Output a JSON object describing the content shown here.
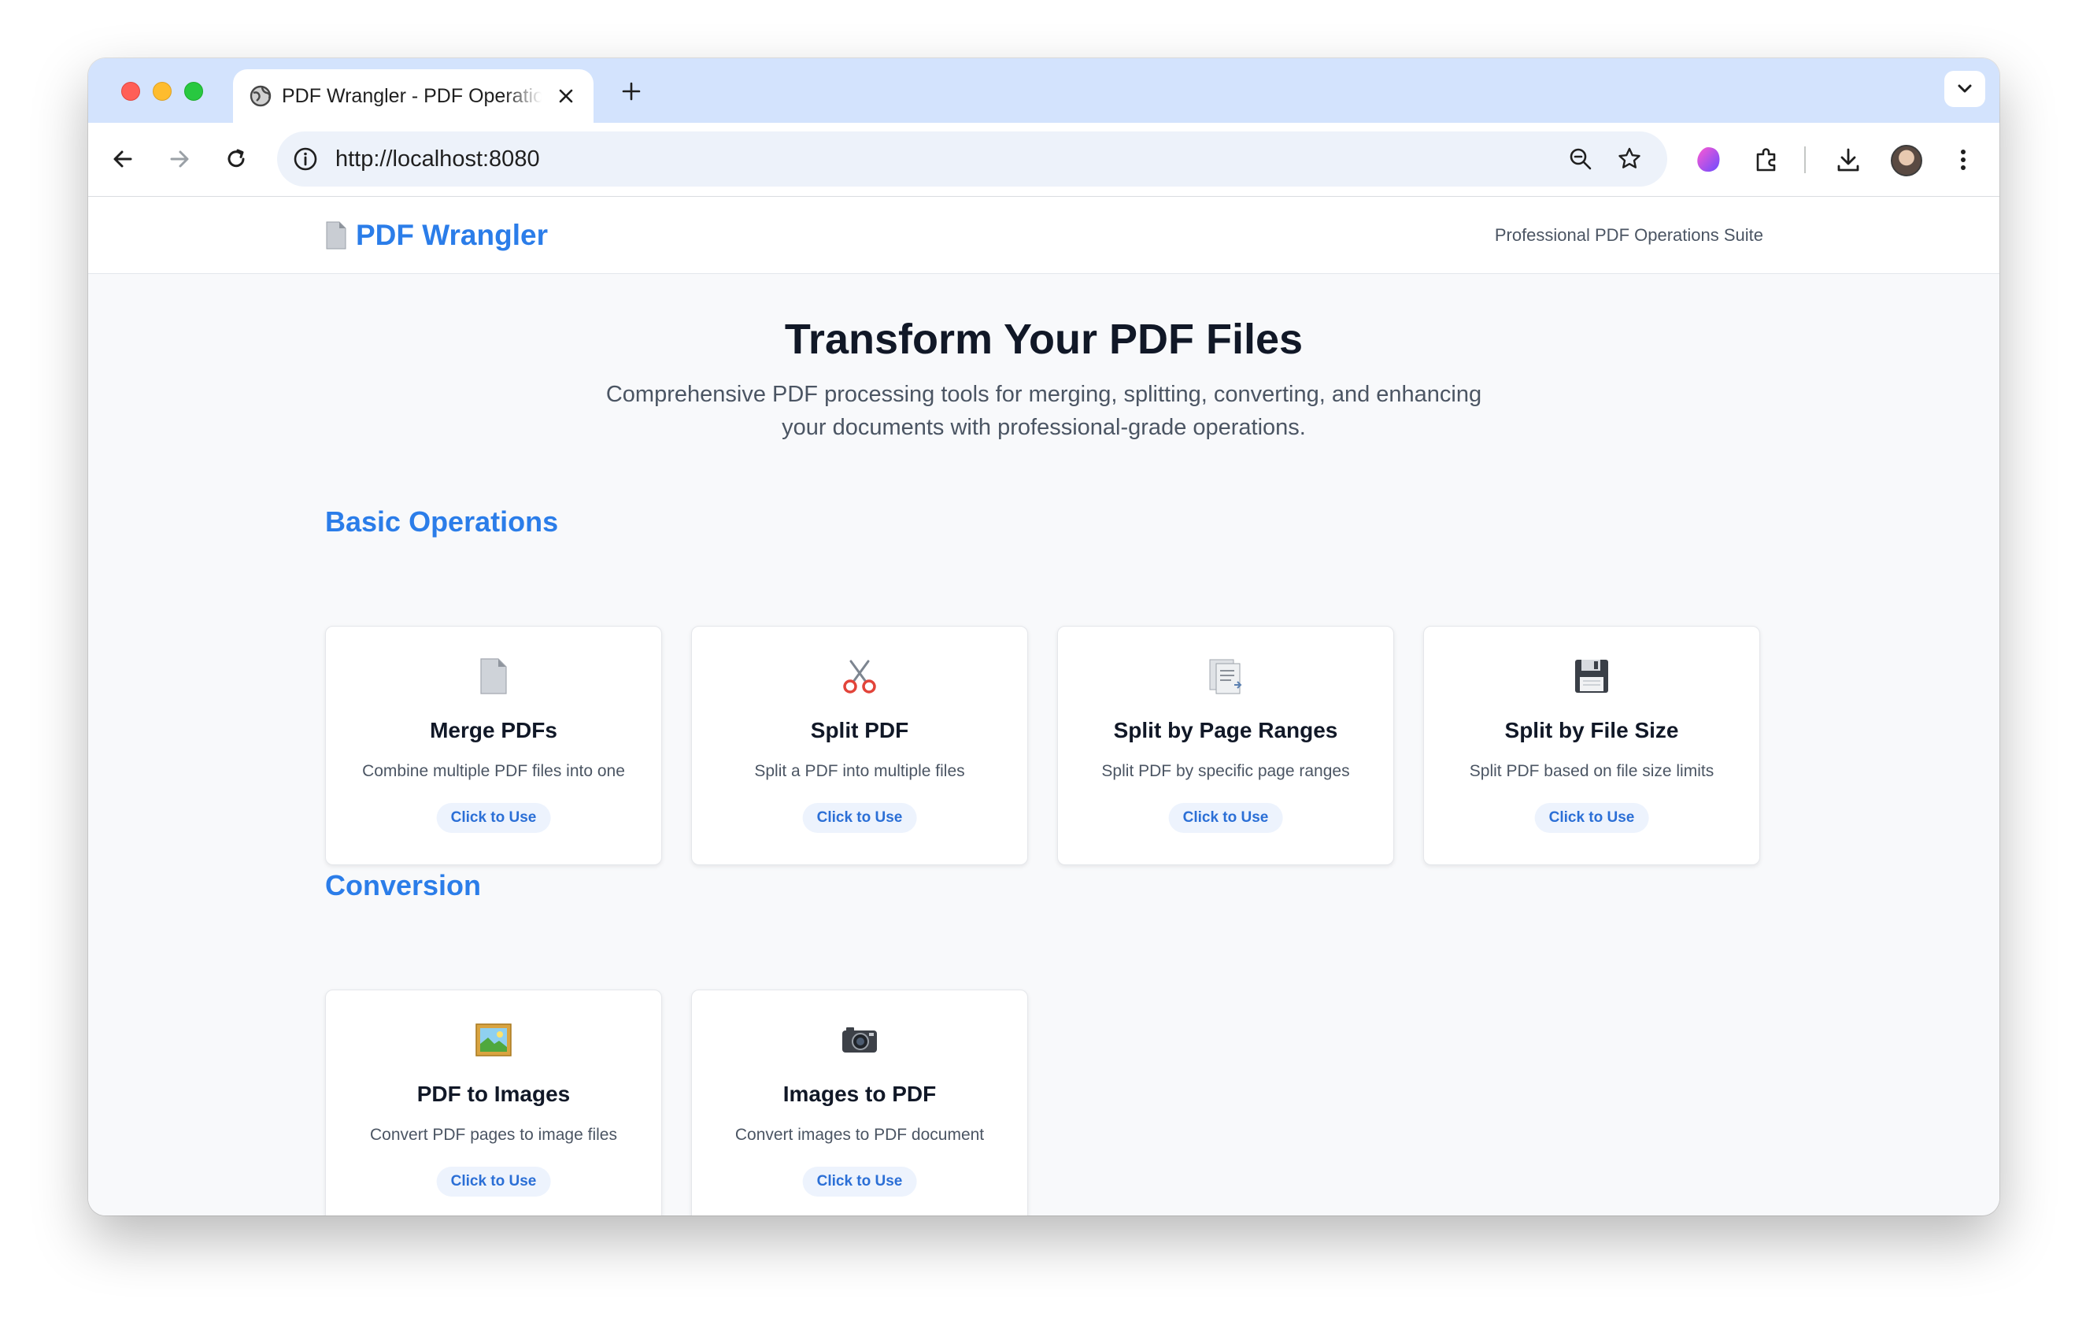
{
  "browser": {
    "tab_title": "PDF Wrangler - PDF Operations",
    "url": "http://localhost:8080"
  },
  "site": {
    "brand": "PDF Wrangler",
    "tagline": "Professional PDF Operations Suite"
  },
  "hero": {
    "title": "Transform Your PDF Files",
    "subtitle": "Comprehensive PDF processing tools for merging, splitting, converting, and enhancing your documents with professional-grade operations."
  },
  "sections": [
    {
      "title": "Basic Operations",
      "cards": [
        {
          "icon": "document-icon",
          "title": "Merge PDFs",
          "desc": "Combine multiple PDF files into one",
          "button": "Click to Use"
        },
        {
          "icon": "scissors-icon",
          "title": "Split PDF",
          "desc": "Split a PDF into multiple files",
          "button": "Click to Use"
        },
        {
          "icon": "pages-icon",
          "title": "Split by Page Ranges",
          "desc": "Split PDF by specific page ranges",
          "button": "Click to Use"
        },
        {
          "icon": "floppy-disk-icon",
          "title": "Split by File Size",
          "desc": "Split PDF based on file size limits",
          "button": "Click to Use"
        }
      ]
    },
    {
      "title": "Conversion",
      "cards": [
        {
          "icon": "framed-picture-icon",
          "title": "PDF to Images",
          "desc": "Convert PDF pages to image files",
          "button": "Click to Use"
        },
        {
          "icon": "camera-icon",
          "title": "Images to PDF",
          "desc": "Convert images to PDF document",
          "button": "Click to Use"
        }
      ]
    }
  ],
  "colors": {
    "accent": "#2b7de9",
    "tab_strip": "#d3e3fd",
    "page_bg": "#f8f9fb"
  }
}
